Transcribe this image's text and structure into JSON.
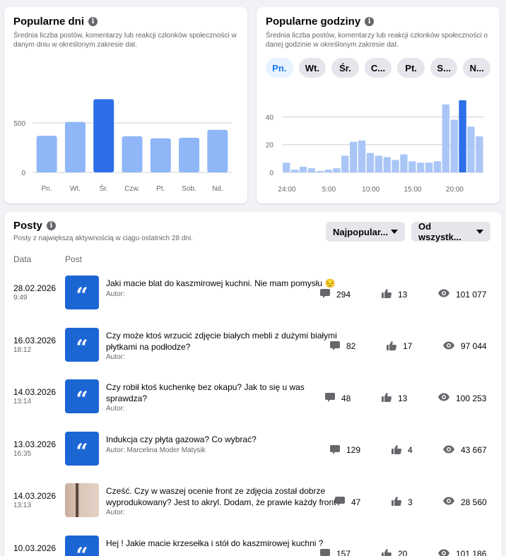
{
  "days_card": {
    "title": "Popularne dni",
    "subtitle": "Średnia liczba postów, komentarzy lub reakcji członków społeczności w danym dniu w określonym zakresie dat.",
    "info_icon": "i"
  },
  "hours_card": {
    "title": "Popularne godziny",
    "subtitle": "Średnia liczba postów, komentarzy lub reakcji członków społeczności o danej godzinie w określonym zakresie dat.",
    "info_icon": "i",
    "day_tabs": [
      "Pn.",
      "Wt.",
      "Śr.",
      "C...",
      "Pt.",
      "S...",
      "N..."
    ],
    "active_tab": 0
  },
  "chart_data": [
    {
      "type": "bar",
      "categories": [
        "Pn.",
        "Wt.",
        "Śr.",
        "Czw.",
        "Pt.",
        "Sob.",
        "Nd."
      ],
      "values": [
        370,
        510,
        740,
        365,
        345,
        350,
        430
      ],
      "highlight_index": 2,
      "yticks": [
        0,
        500
      ],
      "ylim": [
        0,
        800
      ],
      "grid": true,
      "colors": {
        "normal": "#8fb6f7",
        "highlight": "#2c6fe8"
      }
    },
    {
      "type": "bar",
      "x": [
        0,
        1,
        2,
        3,
        4,
        5,
        6,
        7,
        8,
        9,
        10,
        11,
        12,
        13,
        14,
        15,
        16,
        17,
        18,
        19,
        20,
        21,
        22,
        23
      ],
      "values": [
        7,
        2,
        4,
        3,
        1,
        2,
        3,
        12,
        22,
        23,
        14,
        12,
        11,
        9,
        13,
        8,
        7,
        7,
        8,
        49,
        38,
        52,
        33,
        26
      ],
      "xtick_labels": [
        "24:00",
        "5:00",
        "10:00",
        "15:00",
        "20:00"
      ],
      "xtick_positions": [
        0,
        5,
        10,
        15,
        20
      ],
      "highlight_index": 21,
      "yticks": [
        0,
        20,
        40
      ],
      "ylim": [
        0,
        55
      ],
      "grid": true,
      "colors": {
        "normal": "#a9c6f7",
        "highlight": "#2c6fe8"
      }
    }
  ],
  "posts_card": {
    "title": "Posty",
    "subtitle": "Posty z największą aktywnością w ciągu ostatnich 28 dni.",
    "info_icon": "i",
    "sort_dropdown": "Najpopular...",
    "range_dropdown": "Od wszystk...",
    "col_date": "Data",
    "col_post": "Post",
    "rows": [
      {
        "date": "28.02.2026",
        "time": "9:49",
        "text": "Jaki macie blat do kaszmirowej kuchni. Nie mam pomysłu 😔",
        "author": "Autor:",
        "comments": "294",
        "likes": "13",
        "views": "101 077",
        "thumb": "quote"
      },
      {
        "date": "16.03.2026",
        "time": "18:12",
        "text": "Czy może ktoś wrzucić zdjęcie białych mebli z dużymi białymi płytkami na podłodze?",
        "author": "Autor:",
        "comments": "82",
        "likes": "17",
        "views": "97 044",
        "thumb": "quote"
      },
      {
        "date": "14.03.2026",
        "time": "13:14",
        "text": "Czy robił ktoś kuchenkę bez okapu? Jak to się u was sprawdza?",
        "author": "Autor:",
        "comments": "48",
        "likes": "13",
        "views": "100 253",
        "thumb": "quote"
      },
      {
        "date": "13.03.2026",
        "time": "16:35",
        "text": "Indukcja czy płyta gazowa? Co wybrać?",
        "author": "Autor: Marcelina Moder Matysik",
        "comments": "129",
        "likes": "4",
        "views": "43 667",
        "thumb": "quote"
      },
      {
        "date": "14.03.2026",
        "time": "13:13",
        "text": "Cześć. Czy w waszej ocenie front ze zdjęcia został dobrze wyprodukowany? Jest to akryl. Dodam, że prawie każdy front …",
        "author": "Autor:",
        "comments": "47",
        "likes": "3",
        "views": "28 560",
        "thumb": "photo"
      },
      {
        "date": "10.03.2026",
        "time": "",
        "text": "Hej ! Jakie macie krzesełka i stół do kaszmirowej kuchni ?",
        "author": "",
        "comments": "157",
        "likes": "20",
        "views": "101 186",
        "thumb": "quote"
      }
    ]
  },
  "icons": {
    "comment": "comment-icon",
    "like": "thumbs-up-icon",
    "views": "eye-icon",
    "quote": "quote-icon"
  }
}
